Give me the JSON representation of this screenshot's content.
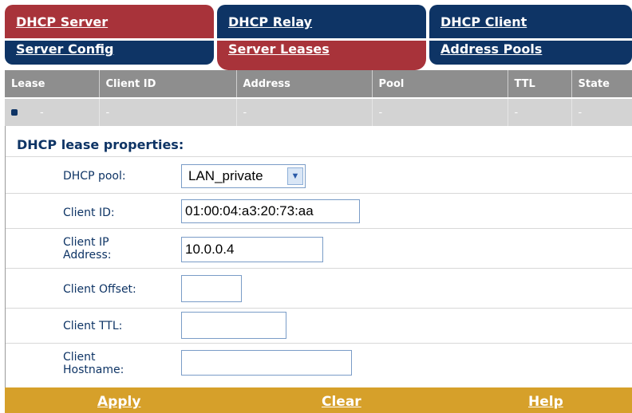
{
  "tabs_top": [
    {
      "label": "DHCP Server",
      "active": true
    },
    {
      "label": "DHCP Relay",
      "active": false
    },
    {
      "label": "DHCP Client",
      "active": false
    }
  ],
  "tabs_sub": [
    {
      "label": "Server Config",
      "active": false
    },
    {
      "label": "Server Leases",
      "active": true
    },
    {
      "label": "Address Pools",
      "active": false
    }
  ],
  "lease_table": {
    "columns": [
      "Lease",
      "Client ID",
      "Address",
      "Pool",
      "TTL",
      "State"
    ],
    "rows": [
      [
        "-",
        "-",
        "-",
        "-",
        "-",
        "-"
      ]
    ]
  },
  "properties": {
    "title": "DHCP lease properties:",
    "pool_label": "DHCP pool:",
    "pool_value": "LAN_private",
    "client_id_label": "Client ID:",
    "client_id_value": "01:00:04:a3:20:73:aa",
    "client_ip_label_1": "Client IP",
    "client_ip_label_2": "Address:",
    "client_ip_value": "10.0.0.4",
    "offset_label": "Client Offset:",
    "offset_value": "",
    "ttl_label": "Client TTL:",
    "ttl_value": "",
    "hostname_label_1": "Client",
    "hostname_label_2": "Hostname:",
    "hostname_value": ""
  },
  "footer": {
    "apply": "Apply",
    "clear": "Clear",
    "help": "Help"
  },
  "colors": {
    "active_tab": "#a8333a",
    "inactive_tab": "#0e3465",
    "footer_bar": "#d6a02a",
    "table_header": "#8e8e8e"
  }
}
